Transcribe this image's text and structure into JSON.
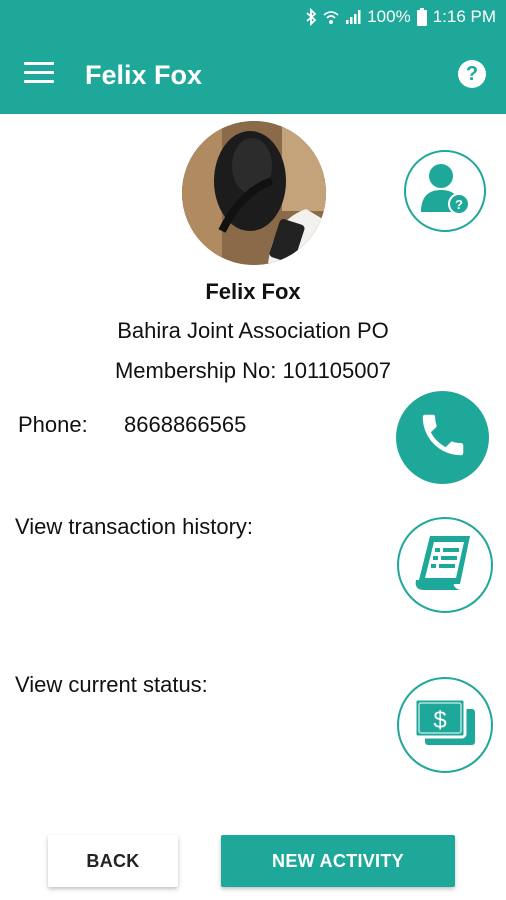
{
  "status_bar": {
    "battery": "100%",
    "time": "1:16 PM"
  },
  "app_bar": {
    "title": "Felix Fox",
    "menu_icon": "hamburger-menu-icon",
    "help_icon": "help-icon"
  },
  "profile": {
    "name": "Felix Fox",
    "organization": "Bahira Joint Association PO",
    "membership_label": "Membership No:",
    "membership_number": "101105007"
  },
  "phone": {
    "label": "Phone:",
    "value": "8668866565"
  },
  "transaction": {
    "label": "View transaction history:"
  },
  "current_status": {
    "label": "View current status:"
  },
  "actions": {
    "back_label": "BACK",
    "new_activity_label": "NEW ACTIVITY"
  },
  "colors": {
    "accent": "#1ea899",
    "background": "#ffffff",
    "text": "#111111"
  }
}
